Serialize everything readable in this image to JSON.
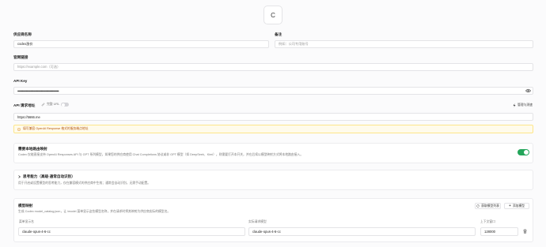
{
  "avatar": {
    "letter": "C"
  },
  "provider_name": {
    "label": "供应商名称",
    "value": "codex涨价"
  },
  "note": {
    "label": "备注",
    "placeholder": "例如：公司专用账号"
  },
  "website": {
    "label": "官网链接",
    "placeholder": "https://example.com（可选）"
  },
  "api_key": {
    "label": "API Key",
    "value": "••••••••••••••••••••••••••••••••••••••••••••••••••••••••••••"
  },
  "api_endpoint": {
    "label": "API 请求地址",
    "full_url_label": "完整 URL",
    "manage_label": "管理与测速",
    "value": "https://5666.me"
  },
  "warning": {
    "text": "填写兼容 OpenAI Response 格式的服务端点地址"
  },
  "local_routing": {
    "title": "需要本地路由映射",
    "description": "Codex 仅能直接支持 OpenAI Responses API 与 GPT 系列模型，如果您的供应商使用 Chat Completions 协议或非 GPT 模型（如 DeepSeek、Kimi），则需要打开本开关，并在后续以模型映射方式将本地路由接入。",
    "enabled": true
  },
  "reasoning": {
    "title": "思考能力（高级·通常自动识别）",
    "description": "用于开启或设置模型的思考能力，仅在兼容模式的供应商中生效；通常会自动识别，无需手动配置。"
  },
  "model_mapping": {
    "title": "模型映射",
    "description": "生成 Codex model_catalog.json，让 /model 菜单显示这些模型名称，并在请求时将其映射为供应商实际的模型名。",
    "fetch_button": "获取模型列表",
    "add_button": "添加模型",
    "columns": [
      "菜单显示名",
      "实际请求模型",
      "上下文窗口"
    ],
    "rows": [
      {
        "display": "claude-opus-4-6-cc",
        "actual": "claude-opus-4-6-cc",
        "context": "128000"
      }
    ]
  }
}
